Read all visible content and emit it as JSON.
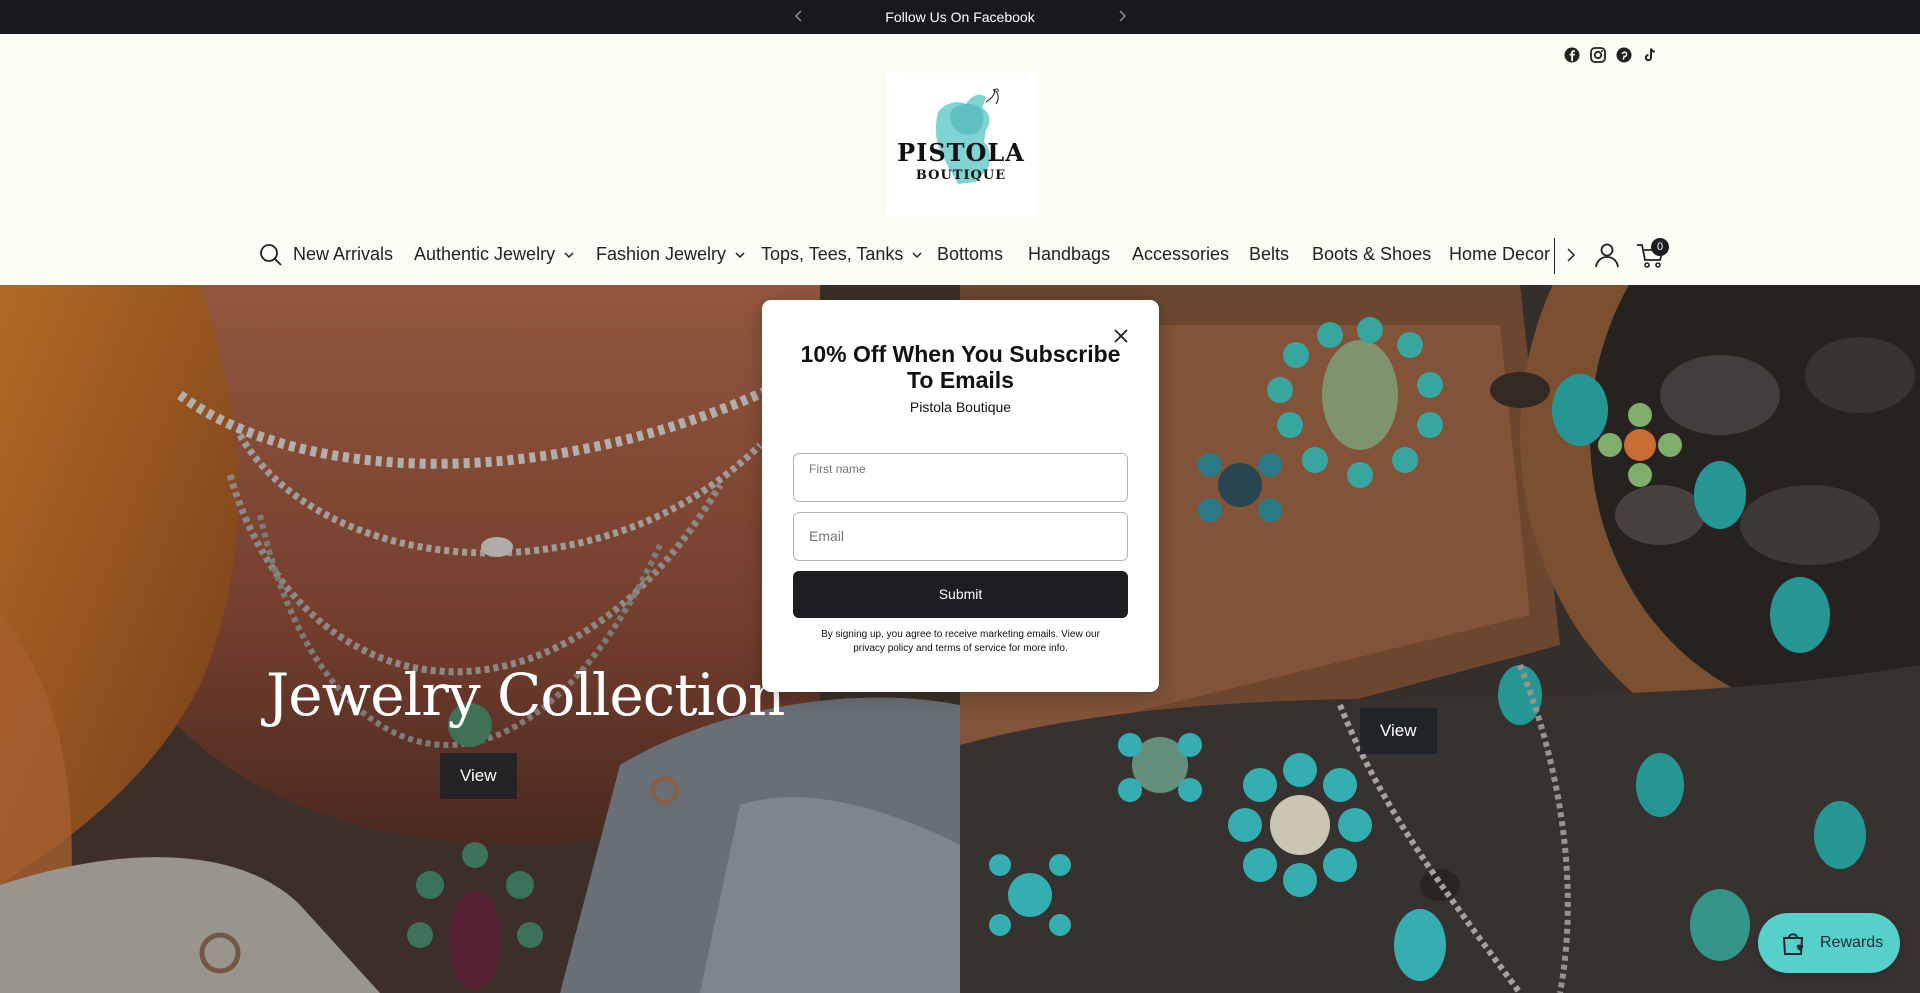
{
  "announcement": {
    "text": "Follow Us On Facebook",
    "prev_icon": "chevron-left-icon",
    "next_icon": "chevron-right-icon"
  },
  "header": {
    "social_icons": [
      "facebook-icon",
      "instagram-icon",
      "pinterest-icon",
      "tiktok-icon"
    ],
    "logo": {
      "line1": "PISTOLA",
      "line2": "BOUTIQUE",
      "accent_color": "#6ec9cc"
    },
    "nav": {
      "items": [
        {
          "label": "New Arrivals",
          "has_dropdown": false
        },
        {
          "label": "Authentic Jewelry",
          "has_dropdown": true
        },
        {
          "label": "Fashion Jewelry",
          "has_dropdown": true
        },
        {
          "label": "Tops, Tees, Tanks",
          "has_dropdown": true
        },
        {
          "label": "Bottoms",
          "has_dropdown": false
        },
        {
          "label": "Handbags",
          "has_dropdown": false
        },
        {
          "label": "Accessories",
          "has_dropdown": false
        },
        {
          "label": "Belts",
          "has_dropdown": false
        },
        {
          "label": "Boots & Shoes",
          "has_dropdown": false
        },
        {
          "label": "Home Decor",
          "has_dropdown": false
        }
      ],
      "cart_count": "0"
    }
  },
  "hero": {
    "left": {
      "title": "Jewelry Collection",
      "button": "View"
    },
    "right": {
      "button": "View"
    }
  },
  "popup": {
    "title": "10% Off When You Subscribe To Emails",
    "brand": "Pistola Boutique",
    "first_name_label": "First name",
    "email_placeholder": "Email",
    "submit": "Submit",
    "legal": "By signing up, you agree to receive marketing emails. View our privacy policy and terms of service for more info."
  },
  "rewards": {
    "label": "Rewards",
    "color": "#55d0ca"
  }
}
